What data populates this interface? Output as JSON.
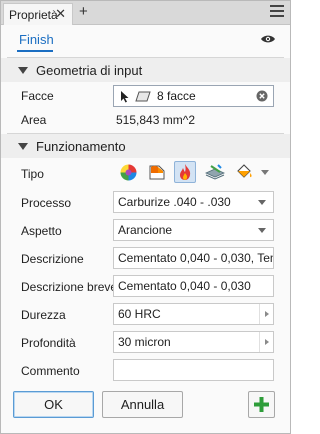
{
  "tab": {
    "title": "Proprietà",
    "close_icon": "close-icon",
    "add_icon": "plus-icon",
    "menu_icon": "hamburger-menu-icon"
  },
  "header": {
    "finish_label": "Finish",
    "visibility_icon": "eye-icon"
  },
  "geometry": {
    "title": "Geometria di input",
    "faces_label": "Facce",
    "faces_value": "8 facce",
    "area_label": "Area",
    "area_value": "515,843 mm^2"
  },
  "function": {
    "title": "Funzionamento",
    "tipo_label": "Tipo",
    "tipo_icons": [
      "appearance-ball-icon",
      "paint-icon",
      "heat-treatment-flame-icon",
      "surface-texture-icon",
      "paint-bucket-icon"
    ],
    "processo_label": "Processo",
    "processo_value": "Carburize .040 - .030",
    "aspetto_label": "Aspetto",
    "aspetto_value": "Arancione",
    "descrizione_label": "Descrizione",
    "descrizione_value": "Cementato 0,040 - 0,030, Tem",
    "descrizione_breve_label": "Descrizione breve",
    "descrizione_breve_value": "Cementato 0,040 - 0,030",
    "durezza_label": "Durezza",
    "durezza_value": "60 HRC",
    "profondita_label": "Profondità",
    "profondita_value": "30 micron",
    "commento_label": "Commento",
    "commento_value": ""
  },
  "buttons": {
    "ok": "OK",
    "cancel": "Annulla",
    "add_icon": "green-plus-icon"
  },
  "colors": {
    "accent": "#1b6ec2",
    "active_icon_bg": "#d3e3f4",
    "add_green": "#2e9d3a"
  }
}
